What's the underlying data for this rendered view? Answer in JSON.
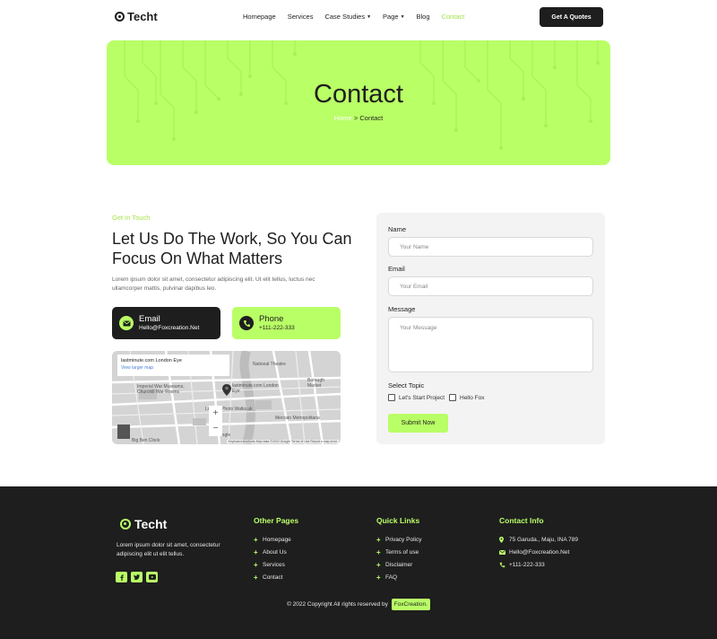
{
  "header": {
    "logo": "Techt",
    "nav": [
      {
        "label": "Homepage",
        "has_caret": false,
        "active": false
      },
      {
        "label": "Services",
        "has_caret": false,
        "active": false
      },
      {
        "label": "Case Studies",
        "has_caret": true,
        "active": false
      },
      {
        "label": "Page",
        "has_caret": true,
        "active": false
      },
      {
        "label": "Blog",
        "has_caret": false,
        "active": false
      },
      {
        "label": "Contact",
        "has_caret": false,
        "active": true
      }
    ],
    "cta": "Get A Quotes"
  },
  "hero": {
    "title": "Contact",
    "breadcrumb_home": "Home",
    "breadcrumb_sep": " > ",
    "breadcrumb_current": "Contact"
  },
  "contact": {
    "eyebrow": "Get In Touch",
    "headline": "Let Us Do The Work, So You Can Focus On What Matters",
    "lead": "Lorem ipsum dolor sit amet, consectetur adipiscing elit. Ut elit tellus, luctus nec ullamcorper mattis, pulvinar dapibus leo.",
    "email_title": "Email",
    "email_value": "Hello@Foxcreation.Net",
    "phone_title": "Phone",
    "phone_value": "+111-222-333"
  },
  "map": {
    "place_title": "lastminute.com London Eye",
    "view_larger": "View larger map",
    "labels": [
      "National Theatre",
      "Imperial War Museums, Churchill War Rooms",
      "lastminute.com London Eye",
      "London Photo Walks.uk",
      "Borough Market",
      "Mercato Metropolitana",
      "Big Ben Clock",
      "Google"
    ],
    "footer": "Keyboard shortcuts   Map data ©2022 Google   Terms of Use   Report a map error"
  },
  "form": {
    "name_label": "Name",
    "name_placeholder": "Your Name",
    "email_label": "Email",
    "email_placeholder": "Your Email",
    "message_label": "Message",
    "message_placeholder": "Your Message",
    "topic_label": "Select Topic",
    "topic_options": [
      "Let's Start Project",
      "Hello Fox"
    ],
    "submit": "Submit Now"
  },
  "footer": {
    "logo": "Techt",
    "about": "Lorem ipsum dolor sit amet, consectetur adipiscing elit ut elit tellus.",
    "social_icons": [
      "facebook-icon",
      "twitter-icon",
      "youtube-icon"
    ],
    "other_pages_title": "Other Pages",
    "other_pages": [
      "Homepage",
      "About Us",
      "Services",
      "Contact"
    ],
    "quick_links_title": "Quick Links",
    "quick_links": [
      "Privacy Policy",
      "Terms of use",
      "Disclaimer",
      "FAQ"
    ],
    "contact_title": "Contact Info",
    "contact_info": [
      {
        "icon": "map-pin-icon",
        "text": "75 Garuda., Maju, INA 789"
      },
      {
        "icon": "mail-icon",
        "text": "Hello@Foxcreation.Net"
      },
      {
        "icon": "phone-icon",
        "text": "+111-222-333"
      }
    ],
    "copyright": "© 2022 Copyright All rights reserved by",
    "brand": "FoxCreation."
  },
  "colors": {
    "accent": "#b9ff66",
    "dark": "#1e1e1e"
  }
}
